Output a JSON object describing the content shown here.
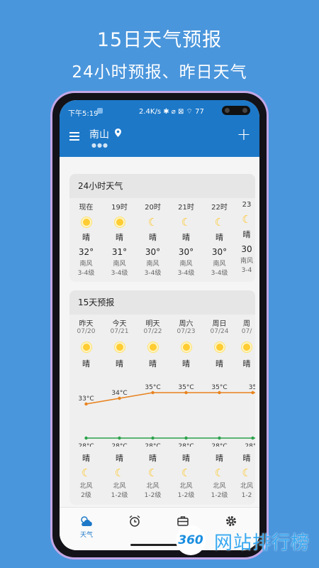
{
  "promo": {
    "title": "15日天气预报",
    "subtitle": "24小时预报、昨日天气"
  },
  "status": {
    "time": "下午5:19",
    "right": "2.4K/s ✱ ⌀ ⊠ ⌔ 77"
  },
  "appbar": {
    "city": "南山",
    "page_dots": "●●●",
    "add": "+"
  },
  "hourly": {
    "title": "24小时天气",
    "hours": [
      {
        "time": "现在",
        "icon": "sun-icon",
        "cond": "晴",
        "temp": "32°",
        "wind": "南风",
        "level": "3-4级"
      },
      {
        "time": "19时",
        "icon": "sun-icon",
        "cond": "晴",
        "temp": "31°",
        "wind": "南风",
        "level": "3-4级"
      },
      {
        "time": "20时",
        "icon": "moon-icon",
        "cond": "晴",
        "temp": "30°",
        "wind": "南风",
        "level": "3-4级"
      },
      {
        "time": "21时",
        "icon": "moon-icon",
        "cond": "晴",
        "temp": "30°",
        "wind": "南风",
        "level": "3-4级"
      },
      {
        "time": "22时",
        "icon": "moon-icon",
        "cond": "晴",
        "temp": "30°",
        "wind": "南风",
        "level": "3-4级"
      },
      {
        "time": "23",
        "icon": "moon-icon",
        "cond": "晴",
        "temp": "30",
        "wind": "南风",
        "level": "3-4"
      }
    ]
  },
  "daily": {
    "title": "15天预报",
    "days": [
      {
        "day": "昨天",
        "date": "07/20",
        "high": "33°C",
        "low": "28°C",
        "night_cond": "晴",
        "wind": "北风",
        "level": "2级"
      },
      {
        "day": "今天",
        "date": "07/21",
        "high": "34°C",
        "low": "28°C",
        "night_cond": "晴",
        "wind": "北风",
        "level": "1-2级"
      },
      {
        "day": "明天",
        "date": "07/22",
        "high": "35°C",
        "low": "28°C",
        "night_cond": "晴",
        "wind": "北风",
        "level": "1-2级"
      },
      {
        "day": "周六",
        "date": "07/23",
        "high": "35°C",
        "low": "28°C",
        "night_cond": "晴",
        "wind": "北风",
        "level": "1-2级"
      },
      {
        "day": "周日",
        "date": "07/24",
        "high": "35°C",
        "low": "28°C",
        "night_cond": "晴",
        "wind": "北风",
        "level": "1-2级"
      },
      {
        "day": "周",
        "date": "07/",
        "high": "35",
        "low": "28°C",
        "night_cond": "晴",
        "wind": "北风",
        "level": "1-2"
      }
    ],
    "day_cond": "晴",
    "high_values": [
      33,
      34,
      35,
      35,
      35,
      35
    ],
    "low_values": [
      28,
      28,
      28,
      28,
      28,
      28
    ],
    "high_color": "#e8821e",
    "low_color": "#2aa24a"
  },
  "tabs": [
    {
      "label": "天气",
      "icon": "weather-icon"
    },
    {
      "label": "",
      "icon": "alarm-clock-icon"
    },
    {
      "label": "",
      "icon": "toolbox-icon"
    },
    {
      "label": "",
      "icon": "gear-icon"
    }
  ],
  "watermark": {
    "logo": "360",
    "text": "网站排行榜"
  },
  "colors": {
    "background": "#4a96dc",
    "appbar": "#1d78c8",
    "accent_tab": "#1d78c8"
  }
}
